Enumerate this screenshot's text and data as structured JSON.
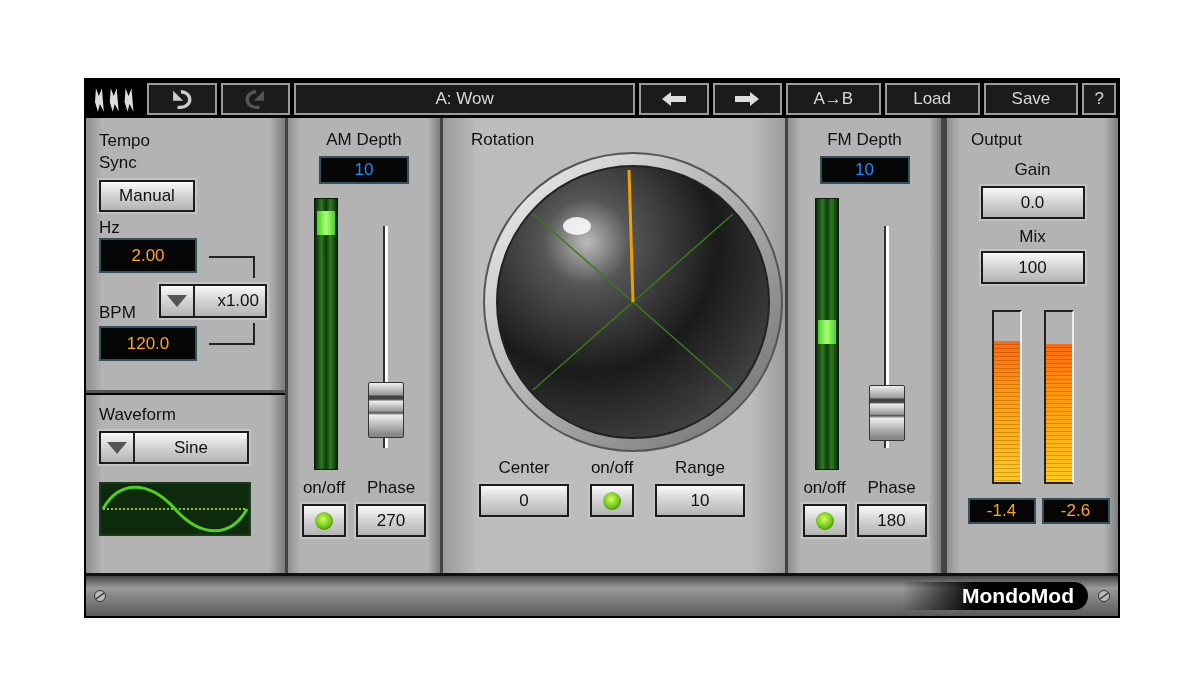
{
  "toolbar": {
    "buttons": [
      {
        "kind": "logo"
      },
      {
        "kind": "undo",
        "disabled": false
      },
      {
        "kind": "redo",
        "disabled": true
      },
      {
        "kind": "preset",
        "label": "A: Wow"
      },
      {
        "kind": "prev"
      },
      {
        "kind": "next"
      },
      {
        "kind": "text",
        "label": "A→B"
      },
      {
        "kind": "text",
        "label": "Load"
      },
      {
        "kind": "text",
        "label": "Save"
      },
      {
        "kind": "text",
        "label": "?"
      }
    ]
  },
  "tempo_sync": {
    "title": "Tempo Sync",
    "mode": "Manual",
    "hz_label": "Hz",
    "hz_value": "2.00",
    "multiplier": "x1.00",
    "bpm_label": "BPM",
    "bpm_value": "120.0"
  },
  "waveform": {
    "title": "Waveform",
    "value": "Sine"
  },
  "am_depth": {
    "title": "AM Depth",
    "value": "10",
    "meter": {
      "level": 0.95
    },
    "fader": {
      "level": 0.06
    },
    "onoff_label": "on/off",
    "on": true,
    "phase_label": "Phase",
    "phase": "270"
  },
  "rotation": {
    "title": "Rotation",
    "center_label": "Center",
    "center": "0",
    "onoff_label": "on/off",
    "on": true,
    "range_label": "Range",
    "range": "10"
  },
  "fm_depth": {
    "title": "FM Depth",
    "value": "10",
    "meter": {
      "level": 0.51
    },
    "fader": {
      "level": 0.04
    },
    "onoff_label": "on/off",
    "on": true,
    "phase_label": "Phase",
    "phase": "180"
  },
  "output": {
    "title": "Output",
    "gain_label": "Gain",
    "gain": "0.0",
    "mix_label": "Mix",
    "mix": "100",
    "meters": [
      {
        "level": 0.83,
        "reading": "-1.4"
      },
      {
        "level": 0.81,
        "reading": "-2.6"
      }
    ]
  },
  "footer": {
    "name": "MondoMod"
  }
}
